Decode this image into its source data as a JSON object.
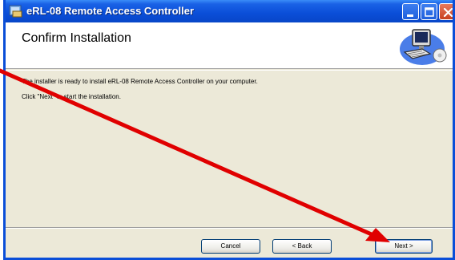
{
  "window": {
    "title": "eRL-08 Remote Access Controller",
    "controls": [
      "minimize",
      "maximize",
      "close"
    ]
  },
  "header": {
    "title": "Confirm Installation",
    "image_icon": "computer-setup-icon"
  },
  "body": {
    "line1": "The installer is ready to install eRL-08 Remote Access Controller on your computer.",
    "line2": "Click \"Next\" to start the installation."
  },
  "buttons": {
    "cancel": "Cancel",
    "back": "< Back",
    "next": "Next >"
  },
  "annotation": {
    "arrow_color": "#e00000",
    "description_icon": "red-arrow-icon"
  },
  "colors": {
    "titlebar": "#0a4ed8",
    "window_bg": "#ece9d8",
    "header_bg": "#ffffff"
  }
}
